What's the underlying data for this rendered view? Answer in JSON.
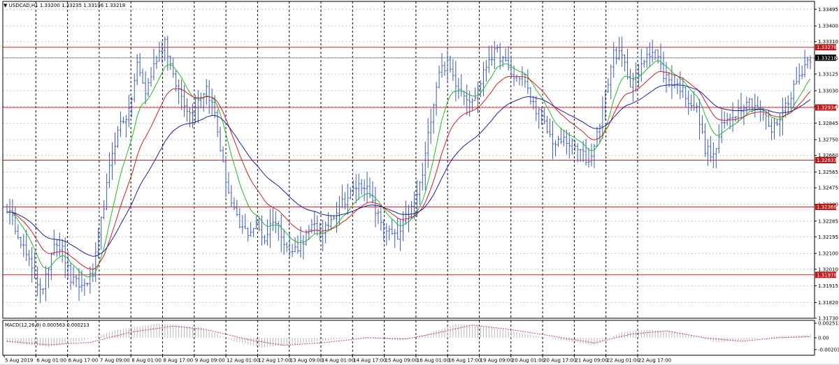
{
  "header": {
    "arrow": "▼",
    "symbol": "USDCAD,H1",
    "open": "1.33200",
    "high": "1.33235",
    "low": "1.33196",
    "close": "1.33218"
  },
  "colors": {
    "candle": "#3b5bb5",
    "ma_fast": "#22bb22",
    "ma_mid": "#cc2020",
    "ma_slow": "#1f1f99",
    "level_line": "#d92020",
    "level_label_bg": "#c01818",
    "price_label_bg": "#000000",
    "macd_hist": "#b8b8b8",
    "macd_signal": "#d24040"
  },
  "chart_data": [
    {
      "type": "candlestick",
      "title": "USDCAD,H1",
      "ylim": [
        1.3173,
        1.3354
      ],
      "y_ticks": [
        1.3173,
        1.3182,
        1.31915,
        1.3201,
        1.321,
        1.32195,
        1.32285,
        1.3238,
        1.32475,
        1.32565,
        1.3266,
        1.3275,
        1.32845,
        1.3294,
        1.3303,
        1.33125,
        1.33215,
        1.3331,
        1.334,
        1.33495
      ],
      "x_labels": [
        "5 Aug 2019",
        "6 Aug 01:00",
        "6 Aug 17:00",
        "7 Aug 09:00",
        "8 Aug 01:00",
        "8 Aug 17:00",
        "9 Aug 09:00",
        "12 Aug 01:00",
        "12 Aug 17:00",
        "13 Aug 09:00",
        "14 Aug 01:00",
        "14 Aug 17:00",
        "15 Aug 09:00",
        "16 Aug 01:00",
        "16 Aug 17:00",
        "19 Aug 09:00",
        "20 Aug 01:00",
        "20 Aug 17:00",
        "21 Aug 09:00",
        "22 Aug 01:00",
        "22 Aug 17:00"
      ],
      "horizontal_levels": [
        "1.33278",
        "1.32934",
        "1.32633",
        "1.32366",
        "1.31978"
      ],
      "current_price": "1.33218",
      "close_path": [
        [
          0,
          1.3236
        ],
        [
          4,
          1.3222
        ],
        [
          9,
          1.32
        ],
        [
          13,
          1.3188
        ],
        [
          17,
          1.3218
        ],
        [
          20,
          1.3212
        ],
        [
          23,
          1.3195
        ],
        [
          27,
          1.3191
        ],
        [
          31,
          1.3198
        ],
        [
          35,
          1.3238
        ],
        [
          38,
          1.3268
        ],
        [
          41,
          1.3285
        ],
        [
          44,
          1.329
        ],
        [
          47,
          1.3318
        ],
        [
          50,
          1.3302
        ],
        [
          54,
          1.3322
        ],
        [
          57,
          1.3332
        ],
        [
          60,
          1.331
        ],
        [
          63,
          1.33
        ],
        [
          66,
          1.329
        ],
        [
          69,
          1.3298
        ],
        [
          72,
          1.3305
        ],
        [
          75,
          1.329
        ],
        [
          78,
          1.326
        ],
        [
          81,
          1.3238
        ],
        [
          84,
          1.3225
        ],
        [
          87,
          1.3222
        ],
        [
          90,
          1.3226
        ],
        [
          93,
          1.3218
        ],
        [
          96,
          1.323
        ],
        [
          99,
          1.3222
        ],
        [
          102,
          1.321
        ],
        [
          105,
          1.3214
        ],
        [
          108,
          1.322
        ],
        [
          111,
          1.3226
        ],
        [
          114,
          1.322
        ],
        [
          117,
          1.323
        ],
        [
          120,
          1.3238
        ],
        [
          123,
          1.3242
        ],
        [
          126,
          1.3248
        ],
        [
          129,
          1.325
        ],
        [
          132,
          1.3238
        ],
        [
          135,
          1.3228
        ],
        [
          138,
          1.3222
        ],
        [
          141,
          1.3218
        ],
        [
          144,
          1.323
        ],
        [
          147,
          1.3238
        ],
        [
          150,
          1.3255
        ],
        [
          153,
          1.3288
        ],
        [
          156,
          1.3315
        ],
        [
          159,
          1.3318
        ],
        [
          162,
          1.3308
        ],
        [
          165,
          1.3302
        ],
        [
          168,
          1.3296
        ],
        [
          171,
          1.3308
        ],
        [
          174,
          1.3322
        ],
        [
          177,
          1.3325
        ],
        [
          180,
          1.3318
        ],
        [
          183,
          1.331
        ],
        [
          186,
          1.3312
        ],
        [
          189,
          1.3298
        ],
        [
          192,
          1.329
        ],
        [
          195,
          1.328
        ],
        [
          198,
          1.3272
        ],
        [
          201,
          1.3275
        ],
        [
          204,
          1.3272
        ],
        [
          207,
          1.3268
        ],
        [
          210,
          1.3262
        ],
        [
          213,
          1.3278
        ],
        [
          216,
          1.33
        ],
        [
          219,
          1.3325
        ],
        [
          222,
          1.3322
        ],
        [
          225,
          1.3308
        ],
        [
          228,
          1.3312
        ],
        [
          231,
          1.3325
        ],
        [
          234,
          1.3326
        ],
        [
          237,
          1.3312
        ],
        [
          240,
          1.3308
        ],
        [
          243,
          1.3305
        ],
        [
          246,
          1.3298
        ],
        [
          249,
          1.3292
        ],
        [
          252,
          1.327
        ],
        [
          255,
          1.3265
        ],
        [
          258,
          1.3282
        ],
        [
          261,
          1.3288
        ],
        [
          264,
          1.3292
        ],
        [
          267,
          1.3298
        ],
        [
          270,
          1.3295
        ],
        [
          273,
          1.329
        ],
        [
          276,
          1.328
        ],
        [
          279,
          1.3288
        ],
        [
          282,
          1.3298
        ],
        [
          285,
          1.3308
        ],
        [
          288,
          1.3318
        ],
        [
          290,
          1.3322
        ]
      ]
    },
    {
      "type": "histogram",
      "title": "MACD(12,26,9) 0.000563 0.000213",
      "ylim": [
        -0.003,
        0.003
      ],
      "y_ticks": [
        "0.002513",
        "0.00",
        "-0.002036"
      ],
      "macd_path": [
        [
          0,
          -0.0008
        ],
        [
          15,
          -0.0016
        ],
        [
          28,
          -0.0004
        ],
        [
          40,
          0.0014
        ],
        [
          55,
          0.0025
        ],
        [
          70,
          0.0018
        ],
        [
          82,
          -0.0006
        ],
        [
          92,
          -0.0017
        ],
        [
          105,
          -0.001
        ],
        [
          118,
          -0.0003
        ],
        [
          130,
          0.0002
        ],
        [
          142,
          -0.0005
        ],
        [
          150,
          0.0004
        ],
        [
          162,
          0.0024
        ],
        [
          175,
          0.0018
        ],
        [
          188,
          0.0006
        ],
        [
          200,
          -0.0004
        ],
        [
          212,
          -0.0013
        ],
        [
          222,
          0.001
        ],
        [
          232,
          0.0014
        ],
        [
          244,
          0.0008
        ],
        [
          256,
          -0.0008
        ],
        [
          266,
          -0.0004
        ],
        [
          278,
          0.0002
        ],
        [
          290,
          0.0006
        ]
      ],
      "signal_path": [
        [
          0,
          -0.0006
        ],
        [
          15,
          -0.0012
        ],
        [
          30,
          -0.0008
        ],
        [
          45,
          0.001
        ],
        [
          60,
          0.002
        ],
        [
          72,
          0.0014
        ],
        [
          88,
          -0.0004
        ],
        [
          100,
          -0.0013
        ],
        [
          115,
          -0.0008
        ],
        [
          130,
          0.0
        ],
        [
          144,
          -0.0002
        ],
        [
          155,
          0.0008
        ],
        [
          168,
          0.0022
        ],
        [
          182,
          0.0014
        ],
        [
          198,
          0.0002
        ],
        [
          212,
          -0.0009
        ],
        [
          225,
          0.0006
        ],
        [
          238,
          0.0012
        ],
        [
          252,
          0.0
        ],
        [
          265,
          -0.0006
        ],
        [
          278,
          0.0
        ],
        [
          290,
          0.0002
        ]
      ]
    }
  ]
}
